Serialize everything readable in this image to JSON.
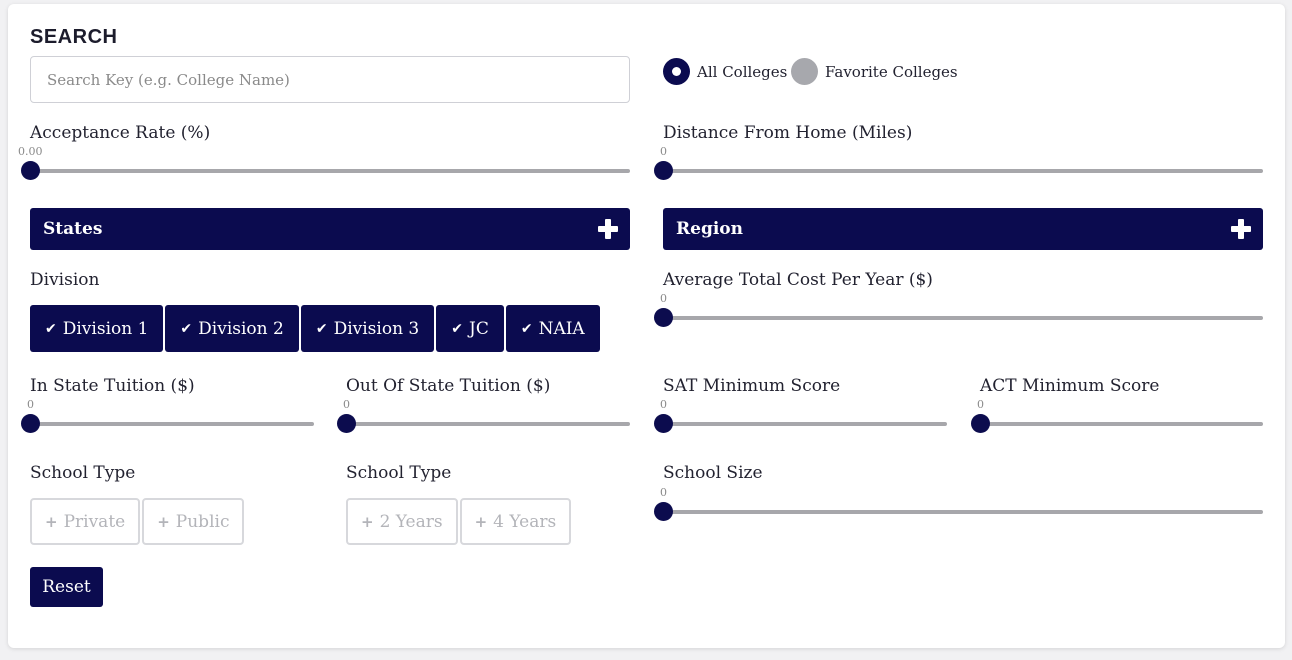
{
  "search": {
    "heading": "SEARCH",
    "placeholder": "Search Key (e.g. College Name)",
    "value": ""
  },
  "scope": {
    "options": [
      {
        "label": "All Colleges",
        "selected": true
      },
      {
        "label": "Favorite Colleges",
        "selected": false
      }
    ]
  },
  "filters": {
    "acceptance_rate": {
      "label": "Acceptance Rate (%)",
      "value_text": "0.00",
      "value": 0
    },
    "distance_from_home": {
      "label": "Distance From Home (Miles)",
      "value_text": "0",
      "value": 0
    },
    "states": {
      "label": "States",
      "icon": "plus-icon"
    },
    "region": {
      "label": "Region",
      "icon": "plus-icon"
    },
    "division": {
      "label": "Division",
      "options": [
        {
          "label": "Division 1",
          "selected": true
        },
        {
          "label": "Division 2",
          "selected": true
        },
        {
          "label": "Division 3",
          "selected": true
        },
        {
          "label": "JC",
          "selected": true
        },
        {
          "label": "NAIA",
          "selected": true
        }
      ]
    },
    "average_total_cost": {
      "label": "Average Total Cost Per Year ($)",
      "value_text": "0",
      "value": 0
    },
    "in_state_tuition": {
      "label": "In State Tuition ($)",
      "value_text": "0",
      "value": 0
    },
    "out_of_state_tuition": {
      "label": "Out Of State Tuition ($)",
      "value_text": "0",
      "value": 0
    },
    "sat_minimum": {
      "label": "SAT Minimum Score",
      "value_text": "0",
      "value": 0
    },
    "act_minimum": {
      "label": "ACT Minimum Score",
      "value_text": "0",
      "value": 0
    },
    "school_type_ownership": {
      "label": "School Type",
      "options": [
        {
          "label": "Private",
          "selected": false
        },
        {
          "label": "Public",
          "selected": false
        }
      ]
    },
    "school_type_length": {
      "label": "School Type",
      "options": [
        {
          "label": "2 Years",
          "selected": false
        },
        {
          "label": "4 Years",
          "selected": false
        }
      ]
    },
    "school_size": {
      "label": "School Size",
      "value_text": "0",
      "value": 0
    }
  },
  "actions": {
    "reset_label": "Reset"
  },
  "colors": {
    "primary": "#0b0b4f",
    "track": "#a7a7ab",
    "inactive_radio": "#a7a8ad",
    "background": "#f1f1f3"
  }
}
